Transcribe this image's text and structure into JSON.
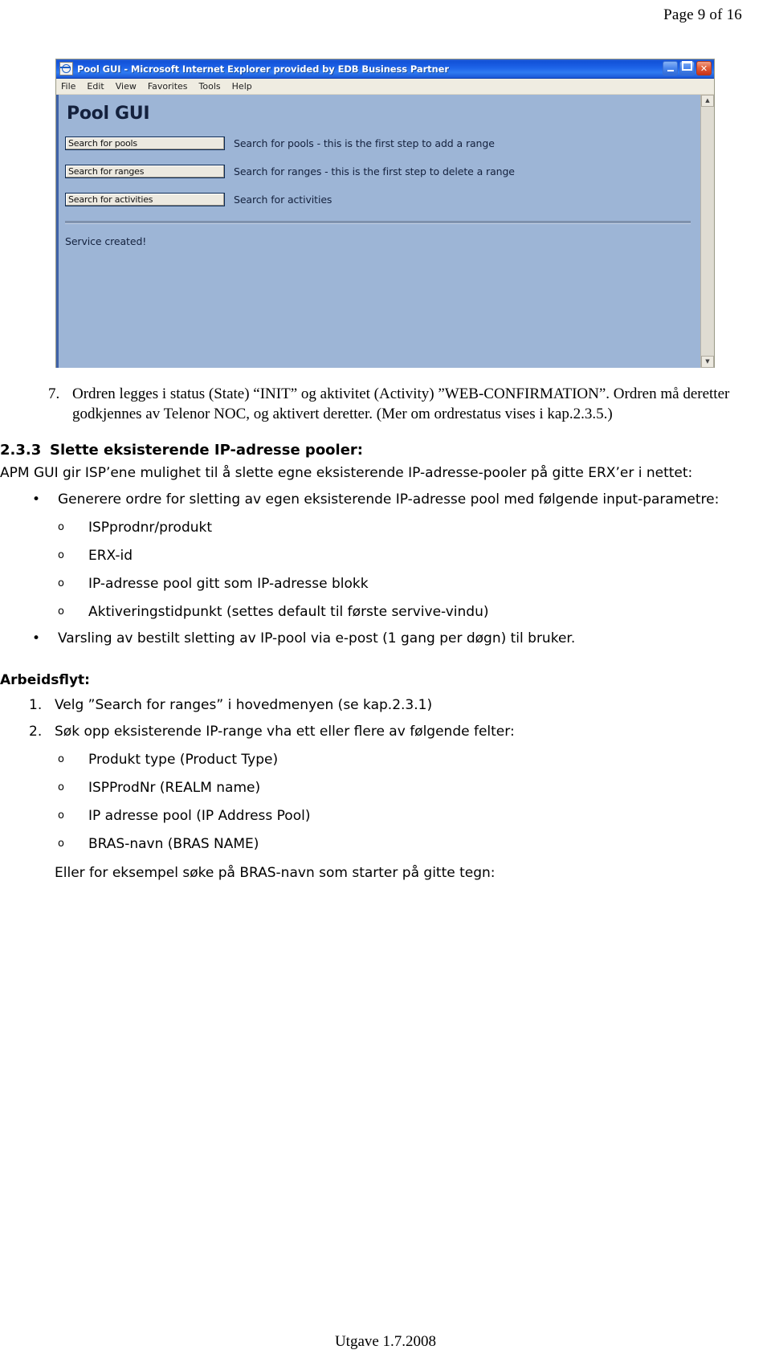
{
  "page": {
    "header": "Page 9 of 16",
    "footer": "Utgave 1.7.2008"
  },
  "screenshot": {
    "titlebar": {
      "title": "Pool GUI - Microsoft Internet Explorer provided by EDB Business Partner",
      "minimize_label": "_",
      "maximize_label": "□",
      "close_label": "✕"
    },
    "menubar": [
      "File",
      "Edit",
      "View",
      "Favorites",
      "Tools",
      "Help"
    ],
    "app_title": "Pool GUI",
    "rows": [
      {
        "button": "Search for pools",
        "description": "Search for pools - this is the first step to add a range"
      },
      {
        "button": "Search for ranges",
        "description": "Search for ranges - this is the first step to delete a range"
      },
      {
        "button": "Search for activities",
        "description": "Search for activities"
      }
    ],
    "status_message": "Service created!",
    "scroll_up": "▲",
    "scroll_down": "▼"
  },
  "document": {
    "item7": {
      "marker": "7.",
      "text": "Ordren legges i status (State) “INIT” og aktivitet (Activity) ”WEB-CONFIRMATION”. Ordren må deretter godkjennes av Telenor NOC, og aktivert deretter. (Mer om ordrestatus vises i kap.2.3.5.)"
    },
    "heading": {
      "number": "2.3.3",
      "label": "Slette eksisterende IP-adresse pooler:"
    },
    "intro": "APM GUI gir ISP’ene mulighet til å slette egne eksisterende IP-adresse-pooler på gitte ERX’er i nettet:",
    "bullet1": {
      "dot": "•",
      "text": "Generere ordre for sletting av egen eksisterende IP-adresse pool med følgende input-parametre:"
    },
    "bullet1_sub": [
      {
        "circ": "o",
        "text": "ISPprodnr/produkt"
      },
      {
        "circ": "o",
        "text": "ERX-id"
      },
      {
        "circ": "o",
        "text": "IP-adresse pool gitt som IP-adresse blokk"
      },
      {
        "circ": "o",
        "text": "Aktiveringstidpunkt (settes default til første servive-vindu)"
      }
    ],
    "bullet2": {
      "dot": "•",
      "text": "Varsling av bestilt sletting av IP-pool via e-post (1 gang per døgn) til bruker."
    },
    "workflow_heading": "Arbeidsflyt:",
    "steps": [
      {
        "n": "1.",
        "text": "Velg ”Search for ranges” i hovedmenyen (se kap.2.3.1)"
      },
      {
        "n": "2.",
        "text": "Søk opp eksisterende IP-range vha ett eller flere av følgende felter:"
      }
    ],
    "step2_sub": [
      {
        "circ": "o",
        "text": "Produkt type (Product Type)"
      },
      {
        "circ": "o",
        "text": "ISPProdNr (REALM name)"
      },
      {
        "circ": "o",
        "text": "IP adresse pool (IP Address Pool)"
      },
      {
        "circ": "o",
        "text": "BRAS-navn (BRAS NAME)"
      }
    ],
    "tail_note": "Eller for eksempel søke på BRAS-navn som starter på gitte tegn:"
  }
}
